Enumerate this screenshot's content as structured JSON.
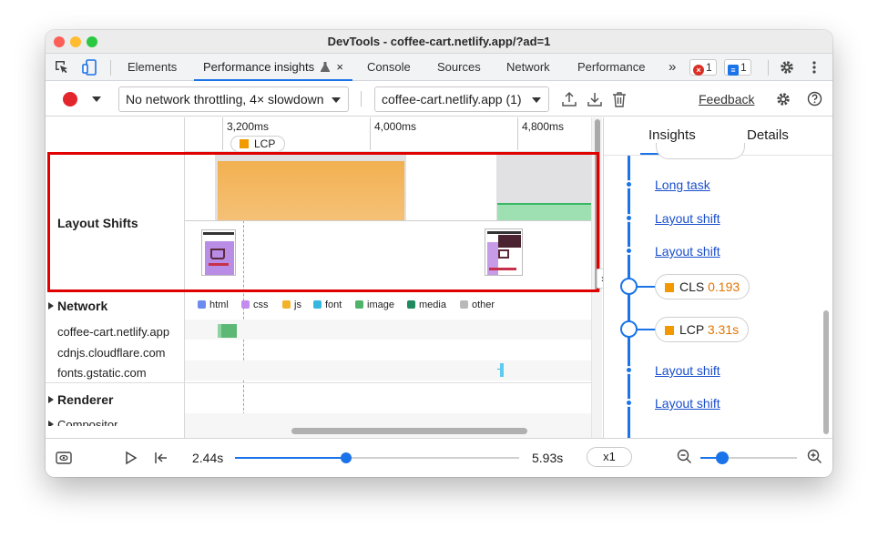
{
  "window": {
    "title": "DevTools - coffee-cart.netlify.app/?ad=1"
  },
  "tabs": [
    {
      "label": "Elements"
    },
    {
      "label": "Performance insights"
    },
    {
      "label": "Console"
    },
    {
      "label": "Sources"
    },
    {
      "label": "Network"
    },
    {
      "label": "Performance"
    }
  ],
  "tabbar": {
    "more": "»",
    "errors": "1",
    "messages": "1",
    "close": "×",
    "experiment_icon": "flask-icon"
  },
  "toolbar": {
    "throttling": "No network throttling, 4× slowdown",
    "recording": "coffee-cart.netlify.app (1)",
    "feedback": "Feedback"
  },
  "timeline": {
    "ruler": [
      "3,200ms",
      "4,000ms",
      "4,800ms"
    ],
    "lcp_marker": "LCP",
    "layout_shifts_label": "Layout Shifts",
    "network_label": "Network",
    "renderer_label": "Renderer",
    "compositor_label": "Compositor",
    "hosts": [
      "coffee-cart.netlify.app",
      "cdnjs.cloudflare.com",
      "fonts.gstatic.com"
    ],
    "legend": [
      {
        "label": "html",
        "color": "#6d8cf0"
      },
      {
        "label": "css",
        "color": "#c58af0"
      },
      {
        "label": "js",
        "color": "#f2b32b"
      },
      {
        "label": "font",
        "color": "#35b7e0"
      },
      {
        "label": "image",
        "color": "#4fb36a"
      },
      {
        "label": "media",
        "color": "#1e8a5e"
      },
      {
        "label": "other",
        "color": "#b9b9b9"
      }
    ]
  },
  "insights": {
    "tabs": [
      "Insights",
      "Details"
    ],
    "items": [
      {
        "kind": "link",
        "label": "Long task"
      },
      {
        "kind": "link",
        "label": "Layout shift"
      },
      {
        "kind": "link",
        "label": "Layout shift"
      },
      {
        "kind": "metric",
        "label": "CLS",
        "value": "0.193"
      },
      {
        "kind": "metric",
        "label": "LCP",
        "value": "3.31s"
      },
      {
        "kind": "link",
        "label": "Layout shift"
      },
      {
        "kind": "link",
        "label": "Layout shift"
      }
    ]
  },
  "footer": {
    "start": "2.44s",
    "end": "5.93s",
    "speed": "x1",
    "playback_position": 0.39,
    "zoom_level": 0.23
  },
  "colors": {
    "accent": "#1a73e8",
    "highlight_border": "#e00000",
    "metric": "#e37400"
  }
}
